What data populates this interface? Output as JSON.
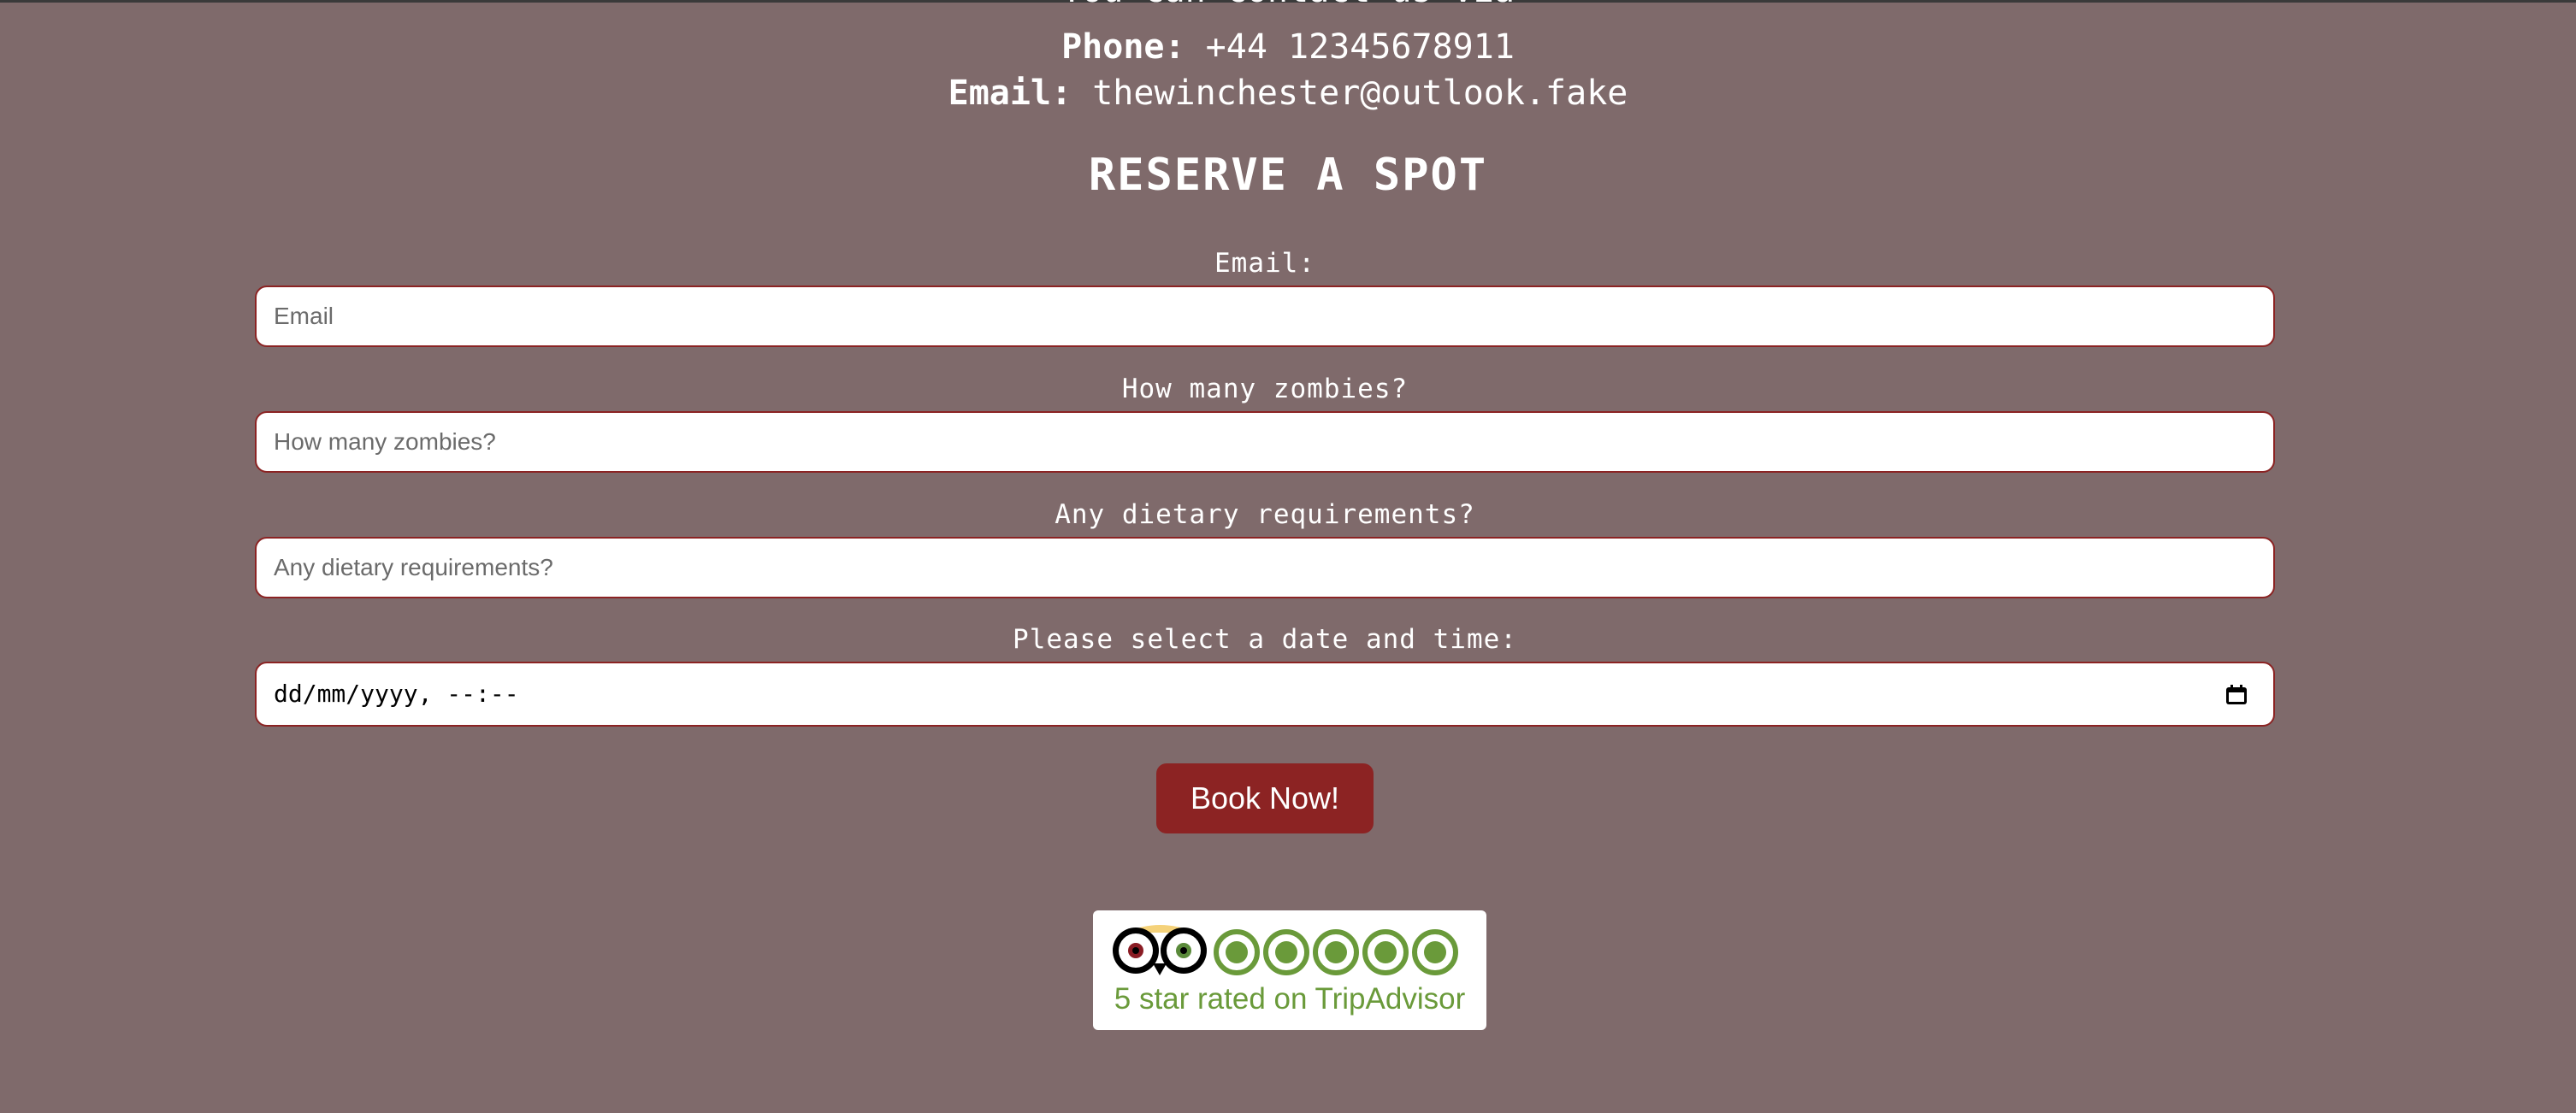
{
  "contact": {
    "intro": "You can contact us via",
    "phone_label": "Phone:",
    "phone_value": "+44 12345678911",
    "email_label": "Email:",
    "email_value": "thewinchester@outlook.fake"
  },
  "reservation": {
    "heading": "RESERVE A SPOT",
    "fields": [
      {
        "label": "Email:",
        "placeholder": "Email",
        "value": ""
      },
      {
        "label": "How many zombies?",
        "placeholder": "How many zombies?",
        "value": ""
      },
      {
        "label": "Any dietary requirements?",
        "placeholder": "Any dietary requirements?",
        "value": ""
      }
    ],
    "date_label": "Please select a date and time:",
    "date_display": "dd/mm/yyyy, --:--",
    "submit_label": "Book Now!"
  },
  "tripadvisor": {
    "caption": "5 star rated on TripAdvisor",
    "rating": 5,
    "max_rating": 5
  },
  "icons": {
    "calendar": "calendar-icon",
    "owl_logo": "tripadvisor-owl-icon",
    "rating_circle": "rating-circle-icon"
  },
  "colors": {
    "background": "#7f6a6b",
    "accent": "#8c2323",
    "field_border": "#8b2323",
    "tripadvisor_green": "#6a9a3a",
    "text": "#ffffff"
  }
}
